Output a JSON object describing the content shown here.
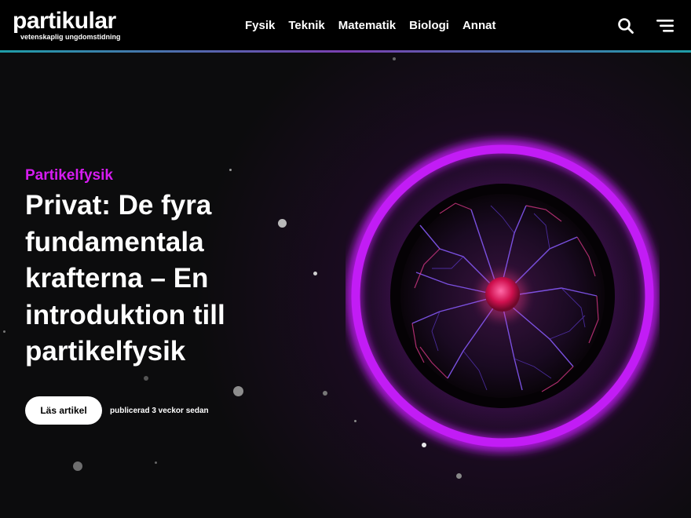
{
  "logo": {
    "name": "partikular",
    "tagline": "vetenskaplig ungdomstidning"
  },
  "nav": {
    "items": [
      "Fysik",
      "Teknik",
      "Matematik",
      "Biologi",
      "Annat"
    ]
  },
  "icons": {
    "search": "search-icon",
    "menu": "hamburger-menu-icon"
  },
  "hero": {
    "category": "Partikelfysik",
    "title": "Privat: De fyra fundamentala krafterna – En introduktion till partikelfysik",
    "read_button": "Läs artikel",
    "published": "publicerad 3 veckor sedan"
  },
  "colors": {
    "accent": "#d61cf0",
    "ring": "#c21cf5",
    "header_bg": "#000000",
    "page_bg": "#0c0c0d"
  }
}
